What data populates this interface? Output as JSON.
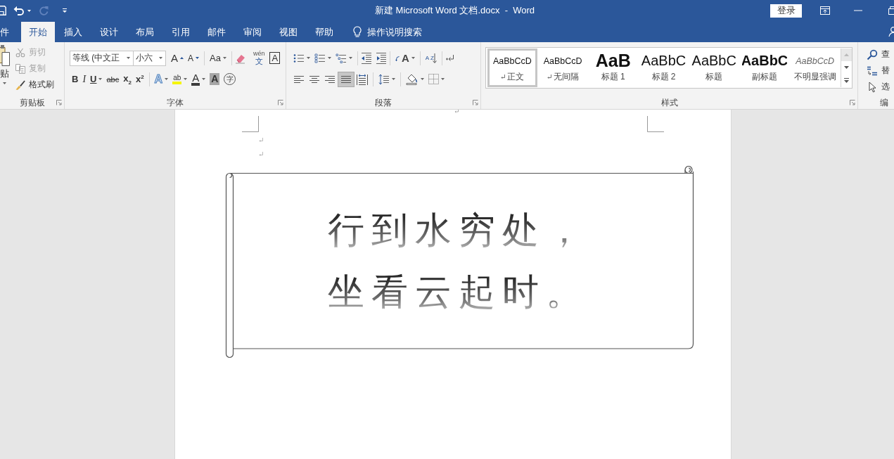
{
  "title_bar": {
    "title": "新建 Microsoft Word 文档.docx  -  Word",
    "sign_in": "登录",
    "redo_disabled": true
  },
  "tabs": [
    {
      "label": "件",
      "selected": false
    },
    {
      "label": "开始",
      "selected": true
    },
    {
      "label": "插入",
      "selected": false
    },
    {
      "label": "设计",
      "selected": false
    },
    {
      "label": "布局",
      "selected": false
    },
    {
      "label": "引用",
      "selected": false
    },
    {
      "label": "邮件",
      "selected": false
    },
    {
      "label": "审阅",
      "selected": false
    },
    {
      "label": "视图",
      "selected": false
    },
    {
      "label": "帮助",
      "selected": false
    }
  ],
  "tell_me": {
    "placeholder": "操作说明搜索"
  },
  "clipboard": {
    "paste_label": "贴",
    "commands": [
      {
        "kind": "cut",
        "label": "剪切",
        "disabled": true
      },
      {
        "kind": "copy",
        "label": "复制",
        "disabled": true
      },
      {
        "kind": "format_painter",
        "label": "格式刷",
        "disabled": false
      }
    ],
    "group_label": "剪贴板"
  },
  "font": {
    "font_name": "等线 (中文正",
    "font_size": "小六",
    "row_1": [
      {
        "kind": "grow",
        "glyph": "A"
      },
      {
        "kind": "shrink",
        "glyph": "A"
      },
      {
        "kind": "change_case",
        "glyph": "Aa"
      },
      {
        "kind": "clear_format"
      },
      {
        "kind": "pinyin",
        "glyph": "wén",
        "sub_glyph": "文"
      },
      {
        "kind": "char_border",
        "glyph": "A"
      }
    ],
    "row_2": [
      {
        "kind": "bold",
        "glyph": "B"
      },
      {
        "kind": "italic",
        "glyph": "I"
      },
      {
        "kind": "underline",
        "glyph": "U"
      },
      {
        "kind": "strikethrough",
        "glyph": "abc"
      },
      {
        "kind": "subscript",
        "glyph": "x$_{2}$"
      },
      {
        "kind": "superscript",
        "glyph": "x$^{2}$"
      },
      {
        "kind": "text_effects",
        "glyph": "A"
      },
      {
        "kind": "highlight",
        "glyph": "ab"
      },
      {
        "kind": "font_color",
        "glyph": "A"
      },
      {
        "kind": "char_shading",
        "glyph": "A"
      },
      {
        "kind": "enclose",
        "glyph": "字"
      }
    ],
    "group_label": "字体"
  },
  "paragraph": {
    "asian_layout_glyph": "A",
    "sort_glyph": "A Z",
    "alignments": [
      {
        "kind": "left",
        "selected": false
      },
      {
        "kind": "center",
        "selected": false
      },
      {
        "kind": "right",
        "selected": false
      },
      {
        "kind": "justify",
        "selected": true
      },
      {
        "kind": "distributed",
        "selected": false
      }
    ],
    "group_label": "段落"
  },
  "styles": {
    "items": [
      {
        "kind": "normal",
        "preview": "AaBbCcD",
        "label": "正文",
        "paragraph_mark": true,
        "selected": true
      },
      {
        "kind": "normal",
        "preview": "AaBbCcD",
        "label": "无间隔",
        "paragraph_mark": true,
        "selected": false
      },
      {
        "kind": "heading_1",
        "preview": "AaB",
        "label": "标题 1",
        "paragraph_mark": false,
        "selected": false
      },
      {
        "kind": "heading_2",
        "preview": "AaBbC",
        "label": "标题 2",
        "paragraph_mark": false,
        "selected": false
      },
      {
        "kind": "title",
        "preview": "AaBbC",
        "label": "标题",
        "paragraph_mark": false,
        "selected": false
      },
      {
        "kind": "subtitle",
        "preview": "AaBbC",
        "label": "副标题",
        "paragraph_mark": false,
        "selected": false
      },
      {
        "kind": "subtle_emphasis",
        "preview": "AaBbCcD",
        "label": "不明显强调",
        "paragraph_mark": false,
        "selected": false
      }
    ],
    "scroll_up_disabled": true,
    "group_label": "样式"
  },
  "editing": {
    "commands": [
      {
        "kind": "find",
        "label": "查"
      },
      {
        "kind": "replace",
        "label": "替"
      },
      {
        "kind": "select",
        "label": "选"
      }
    ],
    "group_label": "编"
  },
  "document": {
    "poem_lines": [
      "行到水穷处，",
      "坐看云起时。"
    ]
  }
}
